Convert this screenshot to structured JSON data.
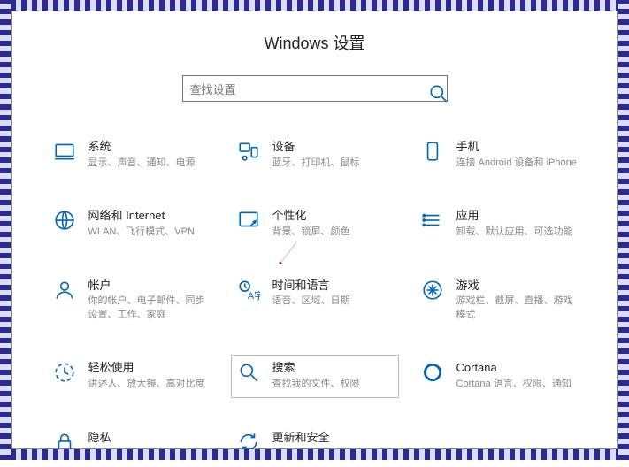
{
  "title": "Windows 设置",
  "search": {
    "placeholder": "查找设置"
  },
  "tiles": {
    "system": {
      "title": "系统",
      "desc": "显示、声音、通知、电源"
    },
    "devices": {
      "title": "设备",
      "desc": "蓝牙、打印机、鼠标"
    },
    "phone": {
      "title": "手机",
      "desc": "连接 Android 设备和 iPhone"
    },
    "network": {
      "title": "网络和 Internet",
      "desc": "WLAN、飞行模式、VPN"
    },
    "personal": {
      "title": "个性化",
      "desc": "背景、锁屏、颜色"
    },
    "apps": {
      "title": "应用",
      "desc": "卸载、默认应用、可选功能"
    },
    "accounts": {
      "title": "帐户",
      "desc": "你的帐户、电子邮件、同步设置、工作、家庭"
    },
    "timelang": {
      "title": "时间和语言",
      "desc": "语音、区域、日期"
    },
    "gaming": {
      "title": "游戏",
      "desc": "游戏栏、截屏、直播、游戏模式"
    },
    "ease": {
      "title": "轻松使用",
      "desc": "讲述人、放大镜、高对比度"
    },
    "search_t": {
      "title": "搜索",
      "desc": "查找我的文件、权限"
    },
    "cortana": {
      "title": "Cortana",
      "desc": "Cortana 语言、权限、通知"
    },
    "privacy": {
      "title": "隐私",
      "desc": "位置、相机、麦克风"
    },
    "update": {
      "title": "更新和安全",
      "desc": "Windows 更新、恢复、备份"
    }
  }
}
